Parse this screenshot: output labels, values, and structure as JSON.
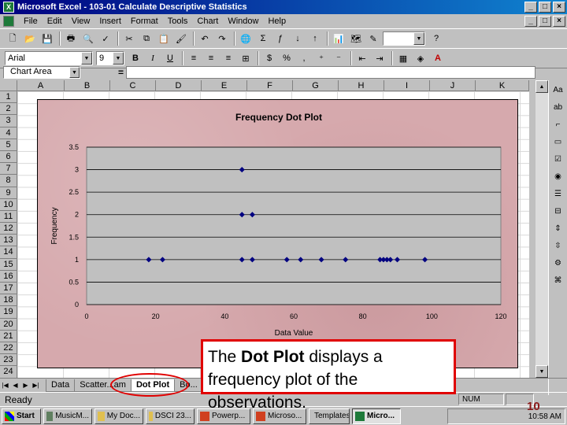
{
  "window": {
    "title": "Microsoft Excel - 103-01 Calculate Descriptive Statistics",
    "controls": [
      "_",
      "□",
      "×"
    ]
  },
  "menu": [
    "File",
    "Edit",
    "View",
    "Insert",
    "Format",
    "Tools",
    "Chart",
    "Window",
    "Help"
  ],
  "toolbar": {
    "font_name": "Arial",
    "font_size": "9",
    "bold": "B",
    "italic": "I",
    "underline": "U"
  },
  "formula_bar": {
    "name_box": "Chart Area",
    "equals": "="
  },
  "columns": [
    "A",
    "B",
    "C",
    "D",
    "E",
    "F",
    "G",
    "H",
    "I",
    "J",
    "K"
  ],
  "rows": [
    "1",
    "2",
    "3",
    "4",
    "5",
    "6",
    "7",
    "8",
    "9",
    "10",
    "11",
    "12",
    "13",
    "14",
    "15",
    "16",
    "17",
    "18",
    "19",
    "20",
    "21",
    "22",
    "23",
    "24"
  ],
  "chart_data": {
    "type": "scatter",
    "title": "Frequency Dot Plot",
    "xlabel": "Data Value",
    "ylabel": "Frequency",
    "xlim": [
      0,
      120
    ],
    "ylim": [
      0,
      3.5
    ],
    "xticks": [
      "0",
      "20",
      "40",
      "60",
      "80",
      "100",
      "120"
    ],
    "yticks": [
      "0",
      "0.5",
      "1",
      "1.5",
      "2",
      "2.5",
      "3",
      "3.5"
    ],
    "grid": true,
    "point_color": "#000080",
    "plot_bg": "#c0c0c0",
    "series": [
      {
        "x": [
          18,
          22,
          45,
          48,
          58,
          62,
          68,
          75,
          85,
          86,
          87,
          88,
          90,
          98,
          45,
          48,
          45
        ],
        "y": [
          1,
          1,
          1,
          1,
          1,
          1,
          1,
          1,
          1,
          1,
          1,
          1,
          1,
          1,
          2,
          2,
          3
        ]
      }
    ]
  },
  "sheet_tabs": [
    "Data",
    "Scatter...am",
    "Dot Plot",
    "Bo..."
  ],
  "active_tab": "Dot Plot",
  "status": {
    "ready": "Ready",
    "num": "NUM"
  },
  "taskbar": {
    "start": "Start",
    "tasks": [
      "MusicM...",
      "My Doc...",
      "DSCI 23...",
      "Powerp...",
      "Microso...",
      "Templates",
      "Micro..."
    ],
    "active_task": "Micro...",
    "clock": "10:58 AM"
  },
  "callout": {
    "prefix": "The ",
    "bold": "Dot Plot",
    "suffix": " displays a",
    "line2": "frequency plot of the",
    "line3": "observations."
  },
  "slide_number": "10"
}
